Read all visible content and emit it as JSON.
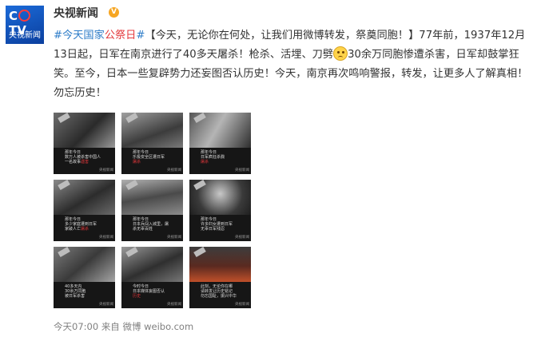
{
  "account": {
    "name": "央视新闻",
    "verified_badge": "V",
    "avatar_logo": "CCTV",
    "avatar_text": "央视新闻"
  },
  "post": {
    "topic": "#今天国家",
    "topic_red": "公祭日",
    "topic_end": "#",
    "text_1": "【今天，无论你在何处，让我们用微博转发，祭奠同胞！】77年前，1937年12月13日起，日军在南京进行了40多天屠杀！枪杀、活埋、刀劈",
    "emoji": "sad-face-emoji",
    "text_2": "30余万同胞惨遭杀害，日军却鼓掌狂笑。至今，日本一些复辟势力还妄图否认历史！今天，南京再次鸣响警报，转发，让更多人了解真相！勿忘历史！"
  },
  "images": [
    {
      "line1": "那年今日",
      "line2": "数万人被杀害中国人",
      "line3": "一名故事",
      "hl": "遇害",
      "mark": "央视新闻"
    },
    {
      "line1": "那年今日",
      "line2": "乐极安全区遭日军",
      "line3": "",
      "hl": "屠杀",
      "mark": "央视新闻"
    },
    {
      "line1": "那年今日",
      "line2": "日军疯狂杀戮",
      "line3": "",
      "hl": "屠杀",
      "mark": "央视新闻"
    },
    {
      "line1": "那年今日",
      "line2": "多少家庭遭到日军",
      "line3": "家破人亡",
      "hl": "屠杀",
      "mark": "央视新闻"
    },
    {
      "line1": "那年今日",
      "line2": "日本兵闯入城里，屠",
      "line3": "杀无辜百姓",
      "hl": "",
      "mark": "央视新闻"
    },
    {
      "line1": "那年今日",
      "line2": "许多妇女遭到日军",
      "line3": "无辜日军残忍",
      "hl": "",
      "mark": "央视新闻"
    },
    {
      "line1": "40多天内",
      "line2": "30余万同胞",
      "line3": "被日军杀害",
      "hl": "",
      "mark": "央视新闻"
    },
    {
      "line1": "今时今日",
      "line2": "日本媒体妄图否认",
      "line3": "",
      "hl": "历史",
      "mark": "央视新闻"
    },
    {
      "line1": "此刻，无论你在哪",
      "line2": "请转发让历史铭记",
      "line3": "勿忘国耻，振兴中华",
      "hl": "",
      "mark": "央视新闻"
    }
  ],
  "footer": {
    "time": "今天07:00",
    "source_prefix": "来自",
    "source": "微博 weibo.com"
  }
}
